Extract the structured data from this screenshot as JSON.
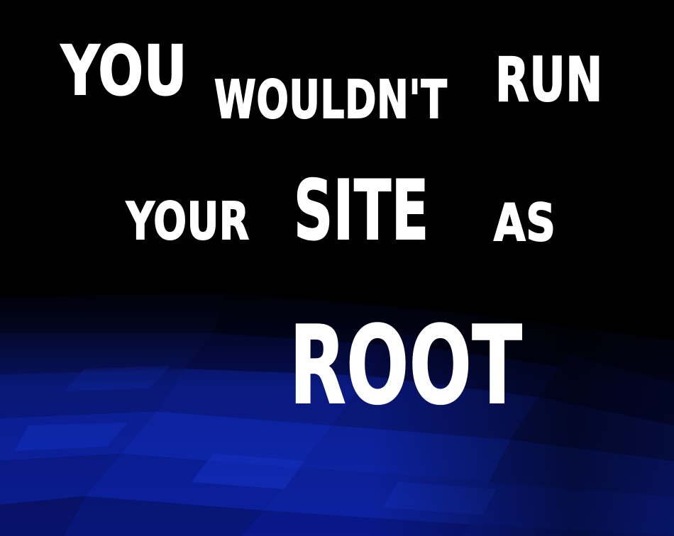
{
  "poster": {
    "line1": {
      "word1": "YOU",
      "word2": "WOULDN'T",
      "word3": "RUN"
    },
    "line2": {
      "word1": "YOUR",
      "word2": "SITE",
      "word3": "AS"
    },
    "line3": {
      "word1": "ROOT"
    }
  },
  "colors": {
    "background": "#000000",
    "text": "#ffffff",
    "accent_blue": "#0a1aa8",
    "deep_blue": "#020a6a"
  }
}
